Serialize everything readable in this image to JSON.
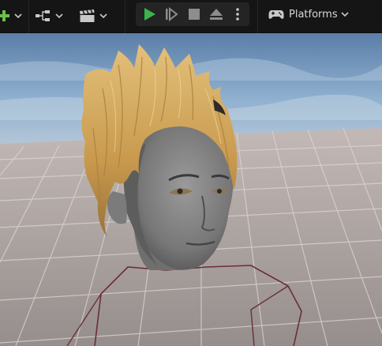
{
  "toolbar": {
    "add_icon": "add-actor-icon",
    "blueprint_icon": "blueprint-graph-icon",
    "cinematics_icon": "clapperboard-icon",
    "play_icon": "play-icon",
    "advance_frame_icon": "advance-frame-icon",
    "stop_icon": "stop-icon",
    "eject_icon": "eject-icon",
    "more_icon": "vertical-ellipsis-icon",
    "platforms_label": "Platforms",
    "platforms_icon": "gamepad-icon"
  },
  "colors": {
    "toolbar_bg": "#151515",
    "play_green": "#39b54a",
    "icon_grey": "#c8c8c8",
    "add_green": "#6cc04a",
    "hair_blonde": "#d6ad64",
    "skin_grey": "#8a8a8a",
    "bone_line": "#6b2e35"
  }
}
